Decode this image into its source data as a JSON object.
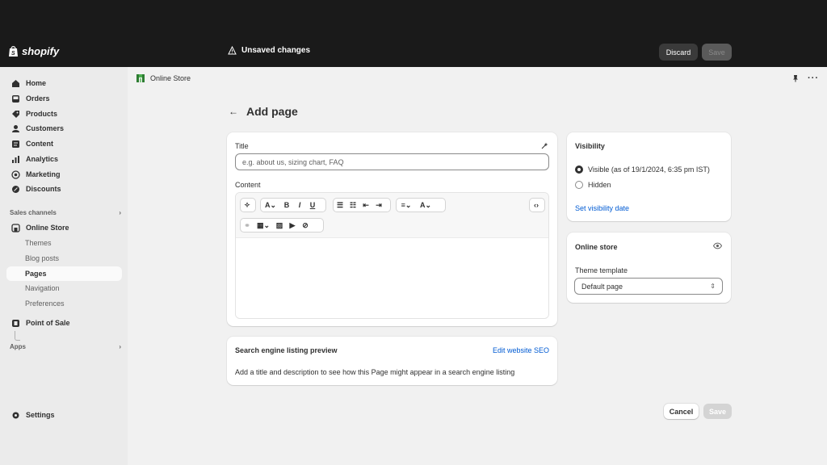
{
  "brand": {
    "name": "shopify"
  },
  "topbar": {
    "status_text": "Unsaved changes",
    "discard_label": "Discard",
    "save_label": "Save"
  },
  "sidebar": {
    "items": [
      {
        "label": "Home",
        "icon": "home-icon"
      },
      {
        "label": "Orders",
        "icon": "inbox-icon"
      },
      {
        "label": "Products",
        "icon": "tag-icon"
      },
      {
        "label": "Customers",
        "icon": "person-icon"
      },
      {
        "label": "Content",
        "icon": "document-icon"
      },
      {
        "label": "Analytics",
        "icon": "bar-chart-icon"
      },
      {
        "label": "Marketing",
        "icon": "target-icon"
      },
      {
        "label": "Discounts",
        "icon": "discount-icon"
      }
    ],
    "sales_channels_label": "Sales channels",
    "online_store_label": "Online Store",
    "online_store_sub": [
      "Themes",
      "Blog posts",
      "Pages",
      "Navigation",
      "Preferences"
    ],
    "point_of_sale_label": "Point of Sale",
    "apps_label": "Apps",
    "settings_label": "Settings"
  },
  "appbar": {
    "title": "Online Store"
  },
  "page": {
    "title": "Add page"
  },
  "form": {
    "title_label": "Title",
    "title_placeholder": "e.g. about us, sizing chart, FAQ",
    "content_label": "Content"
  },
  "seo": {
    "heading": "Search engine listing preview",
    "edit_link": "Edit website SEO",
    "description": "Add a title and description to see how this Page might appear in a search engine listing"
  },
  "visibility": {
    "heading": "Visibility",
    "visible_label": "Visible (as of 19/1/2024, 6:35 pm IST)",
    "hidden_label": "Hidden",
    "set_date_link": "Set visibility date"
  },
  "online_store_card": {
    "heading": "Online store",
    "template_label": "Theme template",
    "template_value": "Default page"
  },
  "footer": {
    "cancel_label": "Cancel",
    "save_label": "Save"
  },
  "colors": {
    "topbar": "#1a1a1a",
    "link": "#005bd3",
    "sidebar": "#ebebeb",
    "main": "#f1f1f1"
  }
}
